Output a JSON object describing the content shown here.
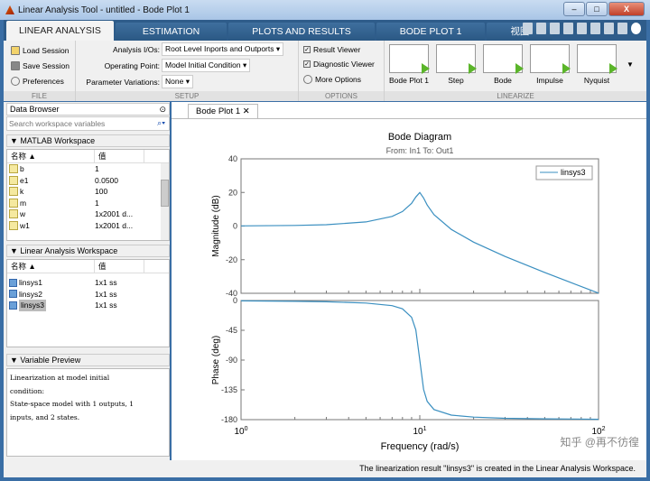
{
  "window": {
    "title": "Linear Analysis Tool - untitled - Bode Plot 1",
    "min": "–",
    "max": "□",
    "close": "X"
  },
  "tabs": [
    "LINEAR ANALYSIS",
    "ESTIMATION",
    "PLOTS AND RESULTS",
    "BODE PLOT 1",
    "视图"
  ],
  "ribbon": {
    "file": {
      "label": "FILE",
      "load": "Load Session",
      "save": "Save Session",
      "prefs": "Preferences"
    },
    "setup": {
      "label": "SETUP",
      "io_label": "Analysis I/Os:",
      "io_value": "Root Level Inports and Outports",
      "op_label": "Operating Point:",
      "op_value": "Model Initial Condition",
      "pv_label": "Parameter Variations:",
      "pv_value": "None"
    },
    "options": {
      "label": "OPTIONS",
      "result_viewer": "Result Viewer",
      "diagnostic_viewer": "Diagnostic Viewer",
      "more": "More Options"
    },
    "linearize": {
      "label": "LINEARIZE",
      "items": [
        "Bode Plot 1",
        "Step",
        "Bode",
        "Impulse",
        "Nyquist"
      ]
    }
  },
  "data_browser": {
    "title": "Data Browser",
    "search_placeholder": "Search workspace variables",
    "matlab_ws": {
      "title": "MATLAB Workspace",
      "col_name": "名称 ▲",
      "col_value": "值",
      "rows": [
        {
          "name": "b",
          "value": "1"
        },
        {
          "name": "e1",
          "value": "0.0500"
        },
        {
          "name": "k",
          "value": "100"
        },
        {
          "name": "m",
          "value": "1"
        },
        {
          "name": "w",
          "value": "1x2001 d..."
        },
        {
          "name": "w1",
          "value": "1x2001 d..."
        }
      ]
    },
    "linear_ws": {
      "title": "Linear Analysis Workspace",
      "col_name": "名称 ▲",
      "col_value": "值",
      "rows": [
        {
          "name": "linsys1",
          "value": "1x1 ss"
        },
        {
          "name": "linsys2",
          "value": "1x1 ss"
        },
        {
          "name": "linsys3",
          "value": "1x1 ss",
          "selected": true
        }
      ]
    },
    "preview": {
      "title": "Variable Preview",
      "lines": [
        "Linearization at model initial",
        "condition:",
        "State-space model with 1 outputs, 1",
        "inputs,  and 2 states."
      ]
    }
  },
  "doc_tab": "Bode Plot 1",
  "status": "The linearization result \"linsys3\" is created in the Linear Analysis Workspace.",
  "watermark": "知乎 @再不彷徨",
  "chart_data": {
    "type": "line",
    "title": "Bode Diagram",
    "subtitle": "From: In1  To: Out1",
    "xlabel": "Frequency  (rad/s)",
    "xscale": "log",
    "xlim": [
      1,
      100
    ],
    "xticks": [
      1,
      10,
      100
    ],
    "xtick_labels": [
      "10^0",
      "10^1",
      "10^2"
    ],
    "color": "#3a8fc0",
    "legend": {
      "entries": [
        "linsys3"
      ],
      "placement": "top-right"
    },
    "grid": false,
    "x": [
      1,
      2,
      3,
      5,
      7,
      8,
      9,
      9.5,
      10,
      10.5,
      11,
      12,
      15,
      20,
      30,
      50,
      70,
      100
    ],
    "magnitude": {
      "ylabel": "Magnitude (dB)",
      "ylim": [
        -40,
        40
      ],
      "yticks": [
        40,
        20,
        0,
        -20,
        -40
      ],
      "values": [
        0.09,
        0.35,
        0.81,
        2.48,
        5.77,
        8.66,
        13.55,
        17.3,
        20,
        16.7,
        12.5,
        6.82,
        -2.0,
        -9.56,
        -18.07,
        -27.6,
        -33.6,
        -39.9
      ]
    },
    "phase": {
      "ylabel": "Phase (deg)",
      "ylim": [
        -180,
        0
      ],
      "yticks": [
        0,
        -45,
        -90,
        -135,
        -180
      ],
      "values": [
        -0.58,
        -1.19,
        -1.89,
        -3.81,
        -7.8,
        -12.5,
        -25.3,
        -44.3,
        -90,
        -134.3,
        -152.4,
        -164.7,
        -173.2,
        -176.2,
        -177.9,
        -178.8,
        -179.1,
        -179.4
      ]
    }
  }
}
